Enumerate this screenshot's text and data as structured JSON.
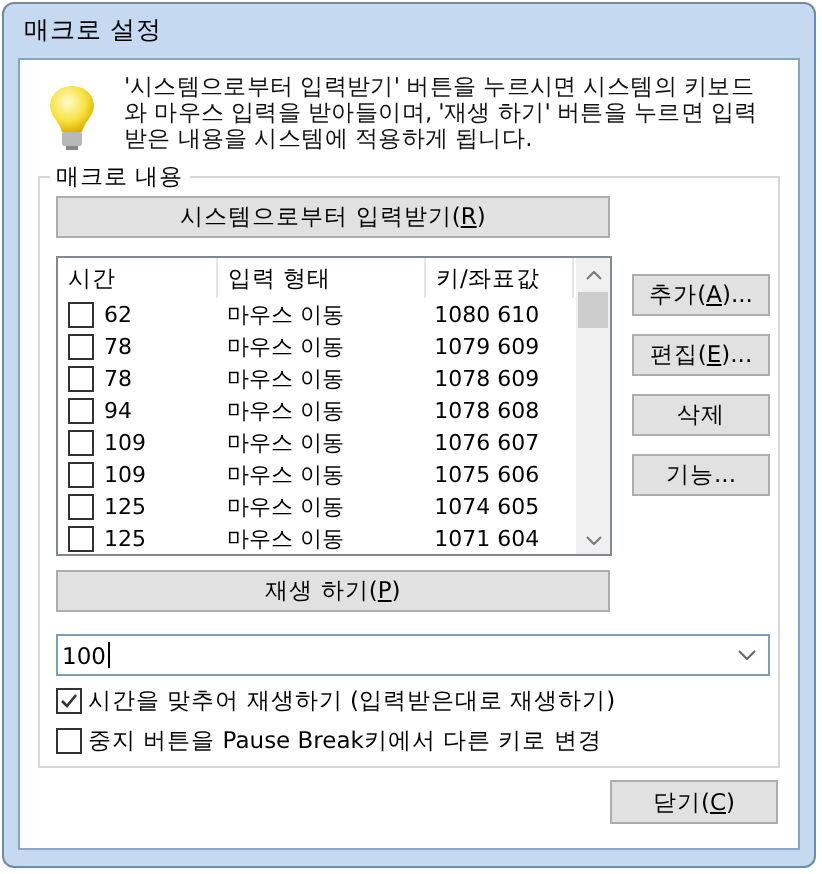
{
  "window": {
    "title": "매크로 설정"
  },
  "info": {
    "text": "'시스템으로부터 입력받기' 버튼을 누르시면 시스템의 키보드와 마우스 입력을 받아들이며, '재생 하기' 버튼을 누르면 입력받은 내용을 시스템에 적용하게 됩니다."
  },
  "group": {
    "label": "매크로 내용"
  },
  "record_button": {
    "before": "시스템으로부터 입력받기(",
    "mnemonic": "R",
    "after": ")"
  },
  "table": {
    "columns": [
      "시간",
      "입력 형태",
      "키/좌표값"
    ],
    "rows": [
      {
        "checked": false,
        "time": "62",
        "type": "마우스 이동",
        "value": "1080 610"
      },
      {
        "checked": false,
        "time": "78",
        "type": "마우스 이동",
        "value": "1079 609"
      },
      {
        "checked": false,
        "time": "78",
        "type": "마우스 이동",
        "value": "1078 609"
      },
      {
        "checked": false,
        "time": "94",
        "type": "마우스 이동",
        "value": "1078 608"
      },
      {
        "checked": false,
        "time": "109",
        "type": "마우스 이동",
        "value": "1076 607"
      },
      {
        "checked": false,
        "time": "109",
        "type": "마우스 이동",
        "value": "1075 606"
      },
      {
        "checked": false,
        "time": "125",
        "type": "마우스 이동",
        "value": "1074 605"
      },
      {
        "checked": false,
        "time": "125",
        "type": "마우스 이동",
        "value": "1071 604"
      }
    ]
  },
  "side_buttons": [
    {
      "before": "추가(",
      "mnemonic": "A",
      "after": ")..."
    },
    {
      "before": "편집(",
      "mnemonic": "E",
      "after": ")..."
    },
    {
      "before": "삭제"
    },
    {
      "before": "기능..."
    }
  ],
  "play_button": {
    "before": "재생 하기(",
    "mnemonic": "P",
    "after": ")"
  },
  "repeat_combo": {
    "value": "100"
  },
  "options": [
    {
      "checked": true,
      "label": "시간을 맞추어 재생하기 (입력받은대로 재생하기)"
    },
    {
      "checked": false,
      "label": "중지 버튼을 Pause Break키에서 다른 키로 변경"
    }
  ],
  "close_button": {
    "before": "닫기(",
    "mnemonic": "C",
    "after": ")"
  }
}
